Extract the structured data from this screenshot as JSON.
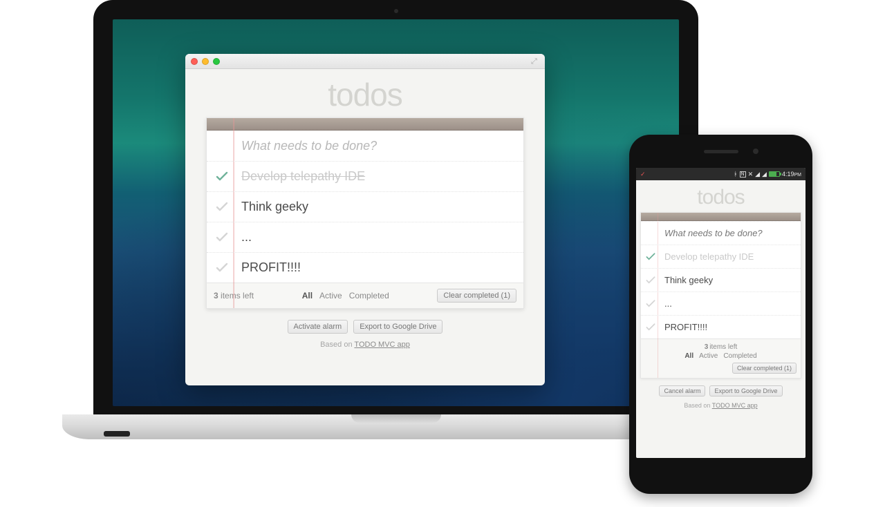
{
  "app": {
    "title": "todos",
    "input_placeholder": "What needs to be done?",
    "items": [
      {
        "text": "Develop telepathy IDE",
        "completed": true
      },
      {
        "text": "Think geeky",
        "completed": false
      },
      {
        "text": "...",
        "completed": false
      },
      {
        "text": "PROFIT!!!!",
        "completed": false
      }
    ],
    "items_left_count": "3",
    "items_left_label": " items left",
    "filters": {
      "all": "All",
      "active": "Active",
      "completed": "Completed",
      "selected": "all"
    },
    "clear_completed_label": "Clear completed (1)",
    "credit_prefix": "Based on ",
    "credit_link": "TODO MVC app"
  },
  "desktop": {
    "buttons": {
      "alarm": "Activate alarm",
      "export": "Export to Google Drive"
    }
  },
  "phone": {
    "status": {
      "carrier_glyph": "✓",
      "time": "4:19",
      "ampm": "PM"
    },
    "buttons": {
      "alarm": "Cancel alarm",
      "export": "Export to Google Drive"
    }
  }
}
